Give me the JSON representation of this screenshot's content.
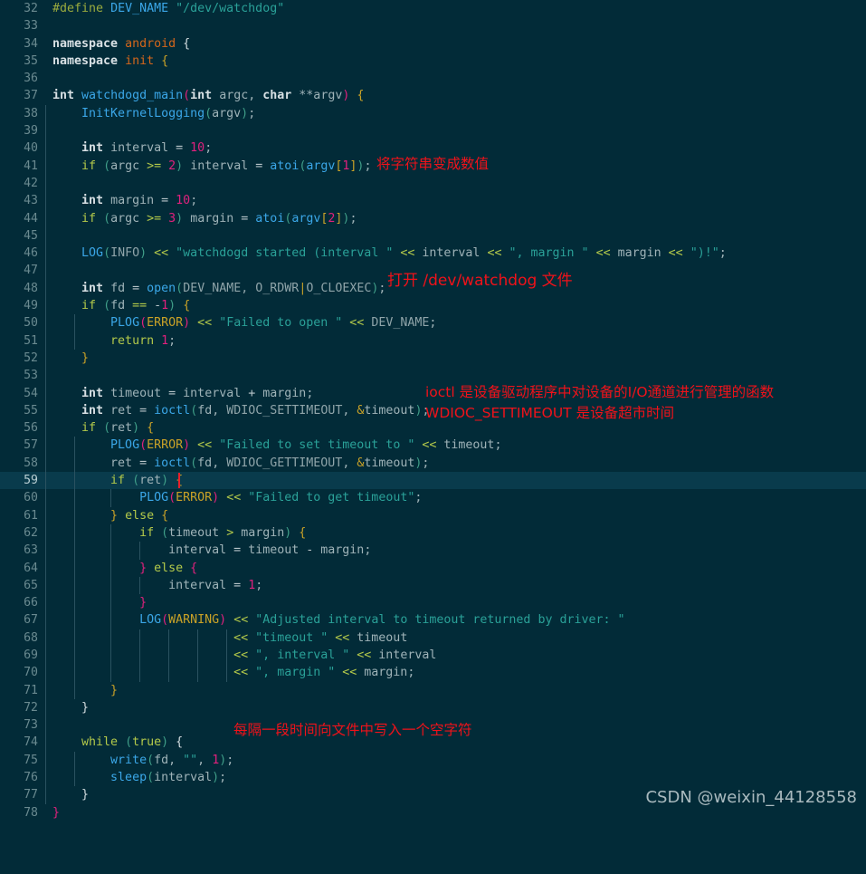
{
  "editor": {
    "background": "#022b38",
    "current_line_background": "#093b4c",
    "gutter_color": "#6a8a90",
    "annotation_color": "#f0121a",
    "cursor_color": "#e8202a",
    "current_line_number": 59,
    "first_line_number": 32,
    "last_line_number": 78,
    "language": "C++"
  },
  "lines": [
    {
      "n": "32",
      "text": "#define DEV_NAME \"/dev/watchdog\""
    },
    {
      "n": "33",
      "text": ""
    },
    {
      "n": "34",
      "text": "namespace android {"
    },
    {
      "n": "35",
      "text": "namespace init {"
    },
    {
      "n": "36",
      "text": ""
    },
    {
      "n": "37",
      "text": "int watchdogd_main(int argc, char **argv) {"
    },
    {
      "n": "38",
      "text": "    InitKernelLogging(argv);"
    },
    {
      "n": "39",
      "text": ""
    },
    {
      "n": "40",
      "text": "    int interval = 10;"
    },
    {
      "n": "41",
      "text": "    if (argc >= 2) interval = atoi(argv[1]);"
    },
    {
      "n": "42",
      "text": ""
    },
    {
      "n": "43",
      "text": "    int margin = 10;"
    },
    {
      "n": "44",
      "text": "    if (argc >= 3) margin = atoi(argv[2]);"
    },
    {
      "n": "45",
      "text": ""
    },
    {
      "n": "46",
      "text": "    LOG(INFO) << \"watchdogd started (interval \" << interval << \", margin \" << margin << \")!\";"
    },
    {
      "n": "47",
      "text": ""
    },
    {
      "n": "48",
      "text": "    int fd = open(DEV_NAME, O_RDWR|O_CLOEXEC);"
    },
    {
      "n": "49",
      "text": "    if (fd == -1) {"
    },
    {
      "n": "50",
      "text": "        PLOG(ERROR) << \"Failed to open \" << DEV_NAME;"
    },
    {
      "n": "51",
      "text": "        return 1;"
    },
    {
      "n": "52",
      "text": "    }"
    },
    {
      "n": "53",
      "text": ""
    },
    {
      "n": "54",
      "text": "    int timeout = interval + margin;"
    },
    {
      "n": "55",
      "text": "    int ret = ioctl(fd, WDIOC_SETTIMEOUT, &timeout);"
    },
    {
      "n": "56",
      "text": "    if (ret) {"
    },
    {
      "n": "57",
      "text": "        PLOG(ERROR) << \"Failed to set timeout to \" << timeout;"
    },
    {
      "n": "58",
      "text": "        ret = ioctl(fd, WDIOC_GETTIMEOUT, &timeout);"
    },
    {
      "n": "59",
      "text": "        if (ret) {"
    },
    {
      "n": "60",
      "text": "            PLOG(ERROR) << \"Failed to get timeout\";"
    },
    {
      "n": "61",
      "text": "        } else {"
    },
    {
      "n": "62",
      "text": "            if (timeout > margin) {"
    },
    {
      "n": "63",
      "text": "                interval = timeout - margin;"
    },
    {
      "n": "64",
      "text": "            } else {"
    },
    {
      "n": "65",
      "text": "                interval = 1;"
    },
    {
      "n": "66",
      "text": "            }"
    },
    {
      "n": "67",
      "text": "            LOG(WARNING) << \"Adjusted interval to timeout returned by driver: \""
    },
    {
      "n": "68",
      "text": "                         << \"timeout \" << timeout"
    },
    {
      "n": "69",
      "text": "                         << \", interval \" << interval"
    },
    {
      "n": "70",
      "text": "                         << \", margin \" << margin;"
    },
    {
      "n": "71",
      "text": "        }"
    },
    {
      "n": "72",
      "text": "    }"
    },
    {
      "n": "73",
      "text": ""
    },
    {
      "n": "74",
      "text": "    while (true) {"
    },
    {
      "n": "75",
      "text": "        write(fd, \"\", 1);"
    },
    {
      "n": "76",
      "text": "        sleep(interval);"
    },
    {
      "n": "77",
      "text": "    }"
    },
    {
      "n": "78",
      "text": "}"
    }
  ],
  "annotations": [
    {
      "id": "note-atoi",
      "text": "将字符串变成数值",
      "line": 41
    },
    {
      "id": "note-open",
      "text": "打开 /dev/watchdog 文件",
      "line": 48
    },
    {
      "id": "note-ioctl-1",
      "text": "ioctl 是设备驱动程序中对设备的I/O通道进行管理的函数",
      "line": 55
    },
    {
      "id": "note-ioctl-2",
      "text": "WDIOC_SETTIMEOUT 是设备超市时间",
      "line": 56
    },
    {
      "id": "note-write",
      "text": "每隔一段时间向文件中写入一个空字符",
      "line": 74
    }
  ],
  "watermark": {
    "text": "CSDN @weixin_44128558"
  }
}
